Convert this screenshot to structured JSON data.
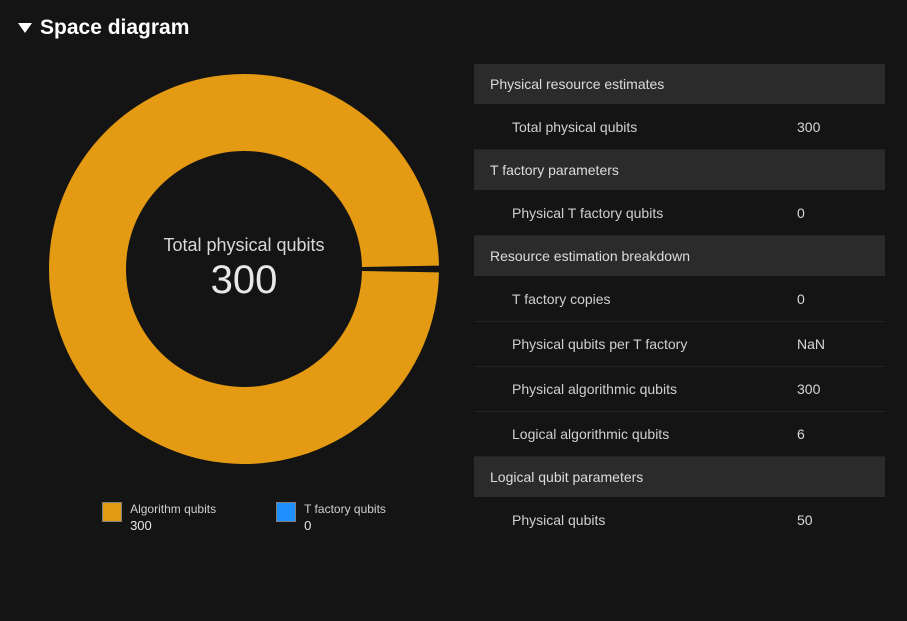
{
  "header": {
    "title": "Space diagram"
  },
  "donut": {
    "center_label": "Total physical qubits",
    "center_value": "300"
  },
  "legend": {
    "items": [
      {
        "label": "Algorithm qubits",
        "value": "300",
        "color": "#e49b13"
      },
      {
        "label": "T factory qubits",
        "value": "0",
        "color": "#1f8fff"
      }
    ]
  },
  "chart_data": {
    "type": "pie",
    "title": "Total physical qubits",
    "total": 300,
    "series": [
      {
        "name": "Algorithm qubits",
        "value": 300,
        "color": "#e49b13"
      },
      {
        "name": "T factory qubits",
        "value": 0,
        "color": "#1f8fff"
      }
    ]
  },
  "table": {
    "sections": [
      {
        "header": "Physical resource estimates",
        "rows": [
          {
            "label": "Total physical qubits",
            "value": "300"
          }
        ]
      },
      {
        "header": "T factory parameters",
        "rows": [
          {
            "label": "Physical T factory qubits",
            "value": "0"
          }
        ]
      },
      {
        "header": "Resource estimation breakdown",
        "rows": [
          {
            "label": "T factory copies",
            "value": "0"
          },
          {
            "label": "Physical qubits per T factory",
            "value": "NaN"
          },
          {
            "label": "Physical algorithmic qubits",
            "value": "300"
          },
          {
            "label": "Logical algorithmic qubits",
            "value": "6"
          }
        ]
      },
      {
        "header": "Logical qubit parameters",
        "rows": [
          {
            "label": "Physical qubits",
            "value": "50"
          }
        ]
      }
    ]
  }
}
